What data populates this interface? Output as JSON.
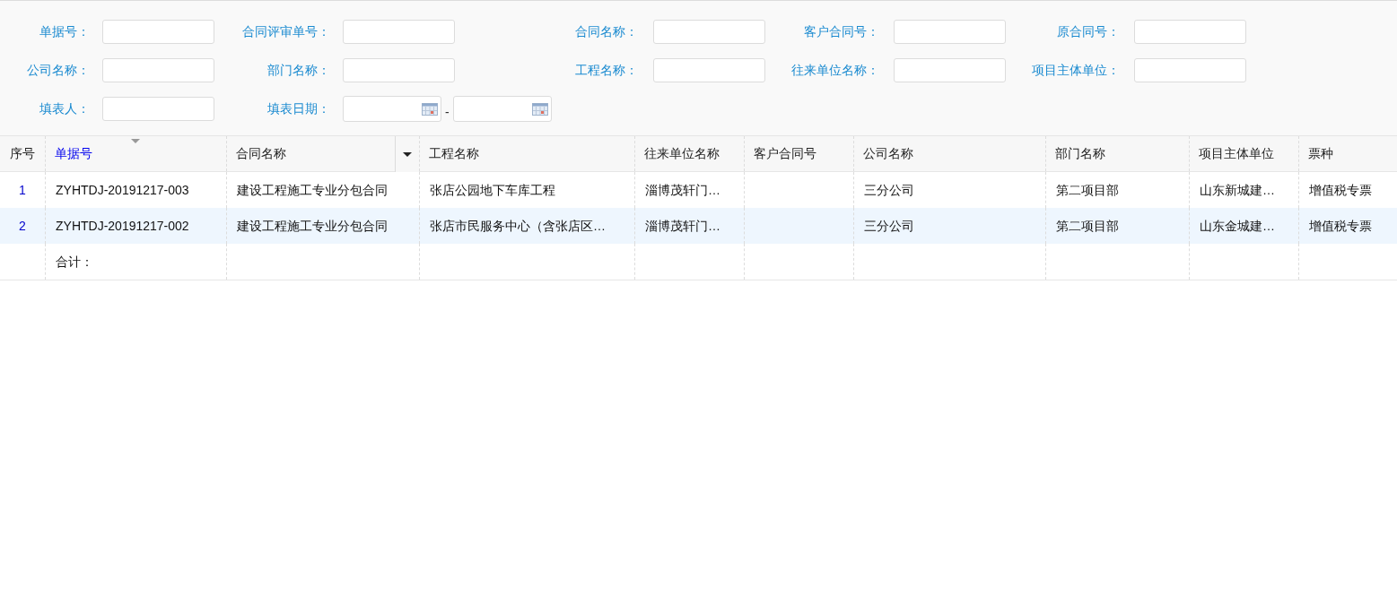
{
  "filters": [
    [
      {
        "kind": "text",
        "label": "单据号："
      },
      {
        "kind": "text",
        "label": "合同评审单号："
      },
      {
        "kind": "text",
        "label": "合同名称："
      },
      {
        "kind": "text",
        "label": "客户合同号："
      },
      {
        "kind": "text",
        "label": "原合同号："
      }
    ],
    [
      {
        "kind": "text",
        "label": "公司名称："
      },
      {
        "kind": "text",
        "label": "部门名称："
      },
      {
        "kind": "text",
        "label": "工程名称："
      },
      {
        "kind": "text",
        "label": "往来单位名称："
      },
      {
        "kind": "text",
        "label": "项目主体单位："
      }
    ],
    [
      {
        "kind": "text",
        "label": "填表人："
      },
      {
        "kind": "date_range",
        "label": "填表日期：",
        "separator": "-"
      }
    ]
  ],
  "table": {
    "columns": [
      {
        "label": "序号",
        "sorted": false,
        "menu": false
      },
      {
        "label": "单据号",
        "sorted": true,
        "menu": false
      },
      {
        "label": "合同名称",
        "sorted": false,
        "menu": true
      },
      {
        "label": "工程名称",
        "sorted": false,
        "menu": false
      },
      {
        "label": "往来单位名称",
        "sorted": false,
        "menu": false
      },
      {
        "label": "客户合同号",
        "sorted": false,
        "menu": false
      },
      {
        "label": "公司名称",
        "sorted": false,
        "menu": false
      },
      {
        "label": "部门名称",
        "sorted": false,
        "menu": false
      },
      {
        "label": "项目主体单位",
        "sorted": false,
        "menu": false
      },
      {
        "label": "票种",
        "sorted": false,
        "menu": false
      }
    ],
    "rows": [
      {
        "selected": false,
        "cells": [
          "1",
          "ZYHTDJ-20191217-003",
          "建设工程施工专业分包合同",
          "张店公园地下车库工程",
          "淄博茂轩门…",
          "",
          "三分公司",
          "第二项目部",
          "山东新城建…",
          "增值税专票"
        ]
      },
      {
        "selected": true,
        "cells": [
          "2",
          "ZYHTDJ-20191217-002",
          "建设工程施工专业分包合同",
          "张店市民服务中心（含张店区…",
          "淄博茂轩门…",
          "",
          "三分公司",
          "第二项目部",
          "山东金城建…",
          "增值税专票"
        ]
      }
    ],
    "footer": {
      "label": "合计："
    }
  }
}
